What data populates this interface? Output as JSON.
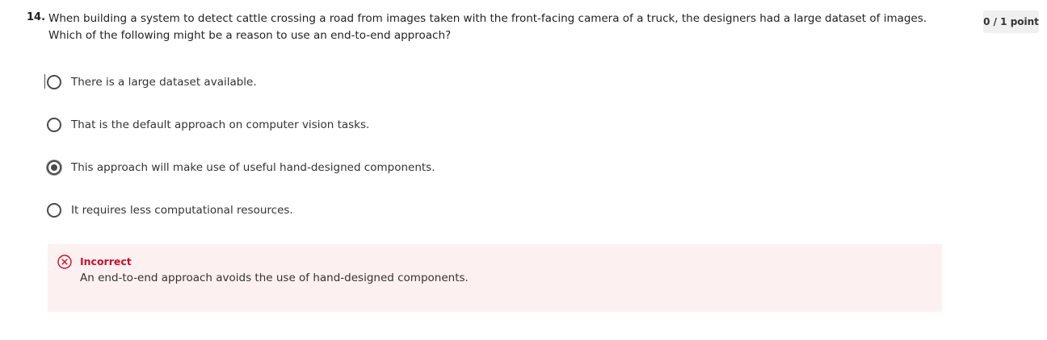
{
  "question": {
    "number": "14.",
    "text": "When building a system to detect cattle crossing a road from images taken with the front-facing camera of a truck, the designers had a large dataset of images. Which of the following might be a reason to use an end-to-end approach?",
    "points": "0 / 1 point"
  },
  "options": [
    {
      "label": "There is a large dataset available.",
      "selected": false
    },
    {
      "label": "That is the default approach on computer vision tasks.",
      "selected": false
    },
    {
      "label": "This approach will make use of useful hand-designed components.",
      "selected": true
    },
    {
      "label": "It requires less computational resources.",
      "selected": false
    }
  ],
  "feedback": {
    "status": "Incorrect",
    "message": "An end-to-end approach avoids the use of hand-designed components.",
    "icon": "close-circle-icon",
    "color": "#c8102e",
    "background": "#fdf0f0"
  }
}
